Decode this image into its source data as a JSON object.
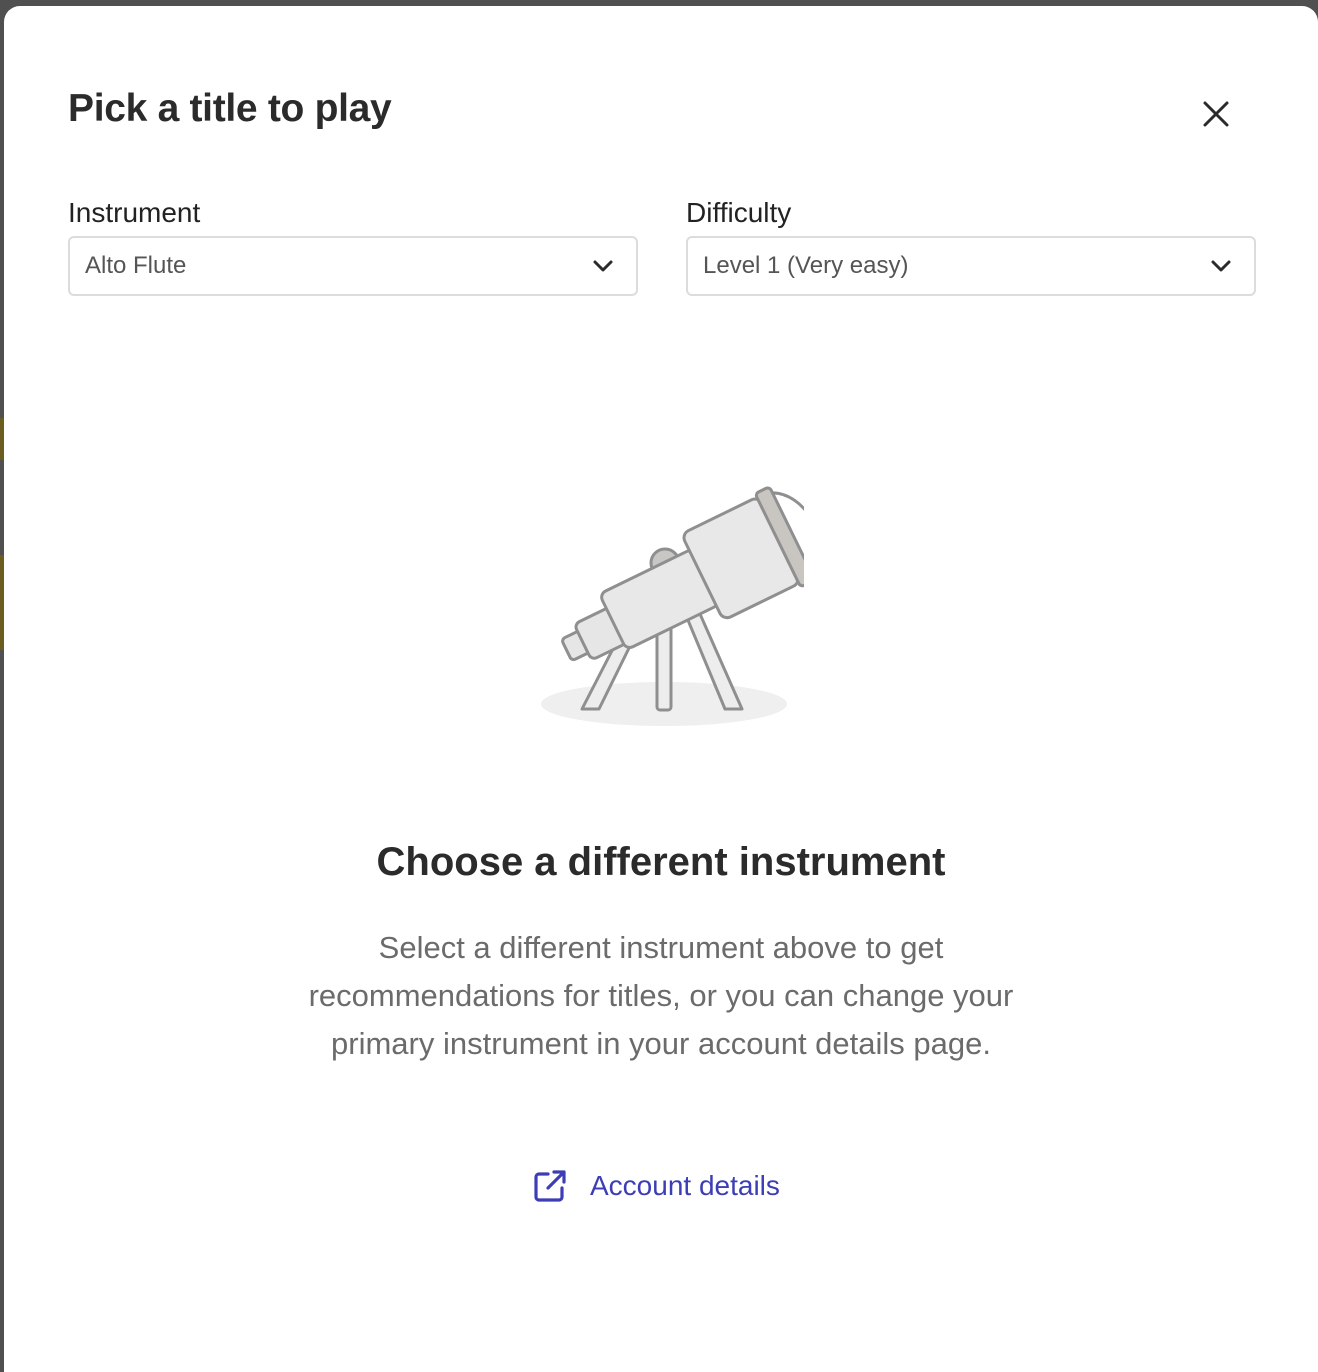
{
  "dialog": {
    "title": "Pick a title to play",
    "close_icon": "close-icon"
  },
  "filters": {
    "instrument": {
      "label": "Instrument",
      "selected": "Alto Flute",
      "icon": "chevron-down-icon"
    },
    "difficulty": {
      "label": "Difficulty",
      "selected": "Level 1 (Very easy)",
      "icon": "chevron-down-icon"
    }
  },
  "empty_state": {
    "illustration": "telescope-icon",
    "title": "Choose a different instrument",
    "description": "Select a different instrument above to get recommendations for titles, or you can change your primary instrument in your account details page.",
    "link_label": "Account details",
    "link_icon": "external-link-icon"
  },
  "colors": {
    "link": "#3d3db5",
    "text_primary": "#2b2b2b",
    "text_secondary": "#6b6b6b",
    "border": "#dcdcdc"
  }
}
